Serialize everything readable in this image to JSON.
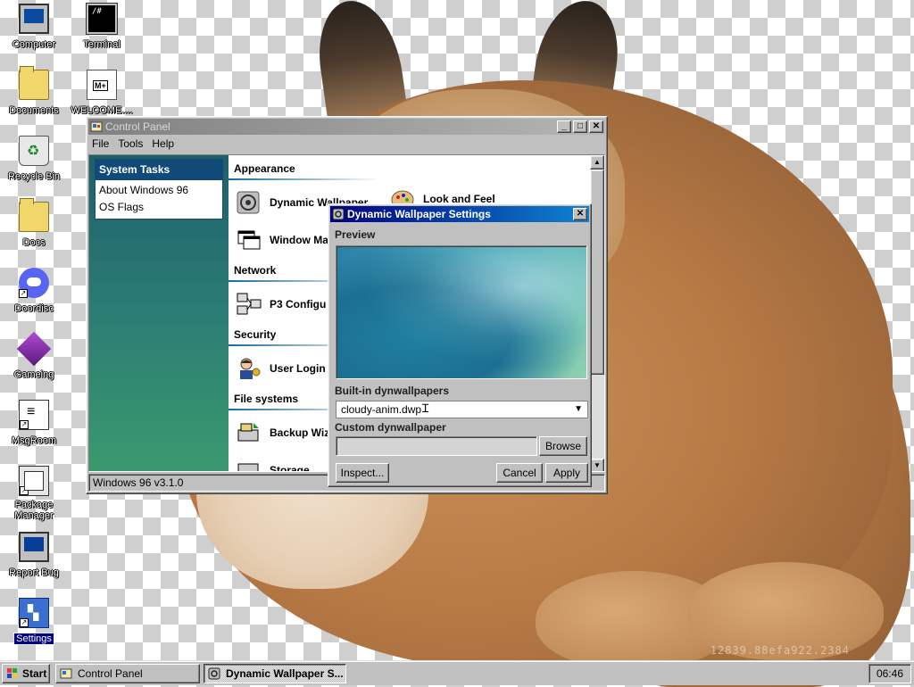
{
  "desktop": {
    "icons": [
      {
        "label": "Computer"
      },
      {
        "label": "Terminal"
      },
      {
        "label": "Documents"
      },
      {
        "label": "WELCOME...."
      },
      {
        "label": "Recycle Bin"
      },
      {
        "label": "Docs"
      },
      {
        "label": "Doordisc"
      },
      {
        "label": "Gameing"
      },
      {
        "label": "MsgRoom"
      },
      {
        "label": "Package Manager"
      },
      {
        "label": "Report Bug"
      },
      {
        "label": "Settings"
      }
    ],
    "watermark": "12839.88efa922.2384"
  },
  "control_panel": {
    "title": "Control Panel",
    "title_buttons": {
      "minimize": "_",
      "maximize": "□",
      "close": "✕"
    },
    "menu": [
      "File",
      "Tools",
      "Help"
    ],
    "tasks": {
      "heading": "System Tasks",
      "items": [
        "About Windows 96",
        "OS Flags"
      ]
    },
    "sections": {
      "appearance": "Appearance",
      "network": "Network",
      "security": "Security",
      "filesystems": "File systems"
    },
    "applets": {
      "dynamic_wallpaper": "Dynamic Wallpaper",
      "look_and_feel": "Look and Feel",
      "window_manager": "Window Ma",
      "p3_config": "P3 Configu",
      "user_login": "User Login",
      "backup": "Backup Wiz",
      "storage": "Storage"
    },
    "status": "Windows 96 v3.1.0"
  },
  "dyn_wallpaper_dialog": {
    "title": "Dynamic Wallpaper Settings",
    "close": "✕",
    "preview_label": "Preview",
    "builtin_label": "Built-in dynwallpapers",
    "builtin_selected": "cloudy-anim.dwp",
    "custom_label": "Custom dynwallpaper",
    "custom_value": "",
    "browse": "Browse",
    "inspect": "Inspect...",
    "cancel": "Cancel",
    "apply": "Apply"
  },
  "taskbar": {
    "start": "Start",
    "tasks": [
      "Control Panel",
      "Dynamic Wallpaper S..."
    ],
    "clock": "06:46"
  }
}
